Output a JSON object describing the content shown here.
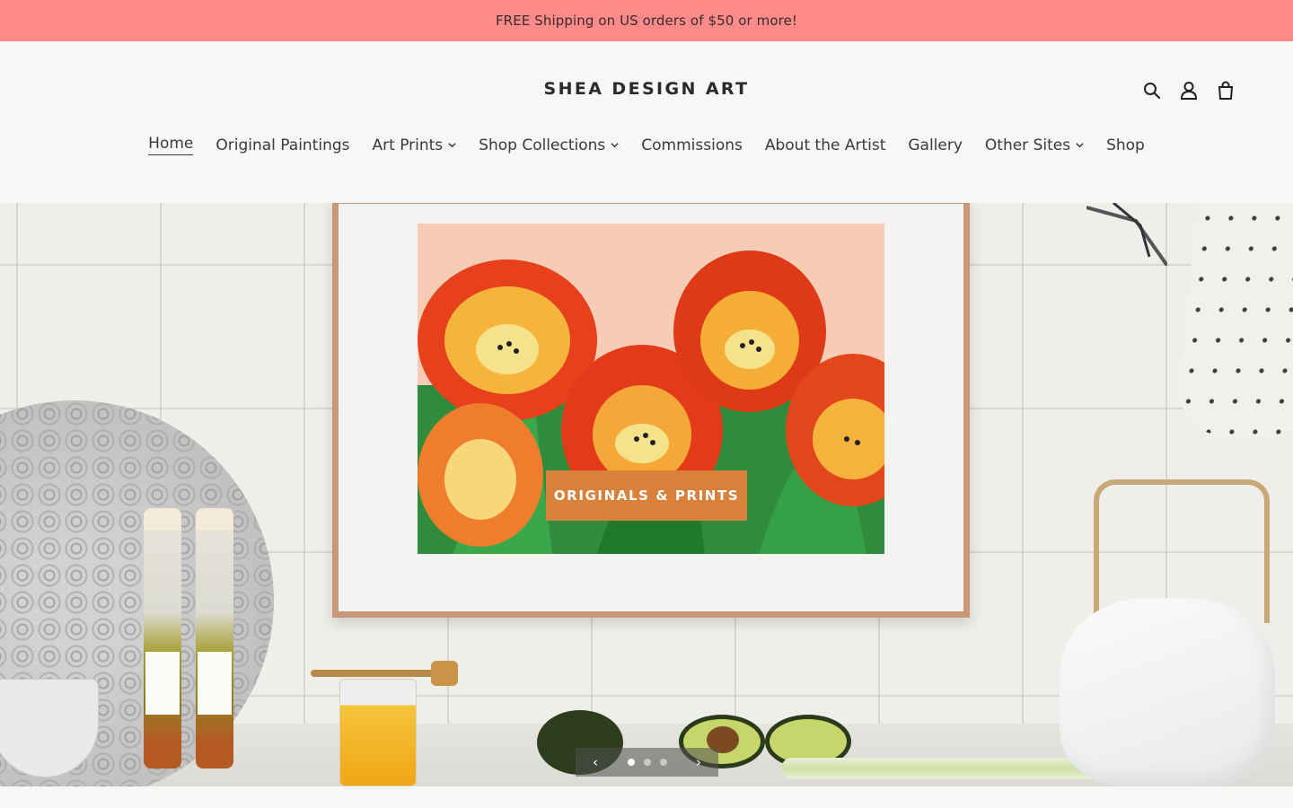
{
  "announcement": {
    "text": "FREE Shipping on US orders of $50 or more!",
    "bg": "#ff8a8a"
  },
  "header": {
    "logo": "SHEA DESIGN ART",
    "icons": [
      "search-icon",
      "account-icon",
      "cart-icon"
    ]
  },
  "nav": {
    "items": [
      {
        "label": "Home",
        "active": true,
        "dropdown": false
      },
      {
        "label": "Original Paintings",
        "dropdown": false
      },
      {
        "label": "Art Prints",
        "dropdown": true
      },
      {
        "label": "Shop Collections",
        "dropdown": true
      },
      {
        "label": "Commissions",
        "dropdown": false
      },
      {
        "label": "About the Artist",
        "dropdown": false
      },
      {
        "label": "Gallery",
        "dropdown": false
      },
      {
        "label": "Other Sites",
        "dropdown": true
      },
      {
        "label": "Shop",
        "dropdown": false
      }
    ]
  },
  "hero": {
    "cta_label": "ORIGINALS & PRINTS",
    "cta_color": "#d9803b",
    "slides_count": 3,
    "active_slide": 1,
    "prev_icon": "chevron-left-icon",
    "next_icon": "chevron-right-icon"
  }
}
